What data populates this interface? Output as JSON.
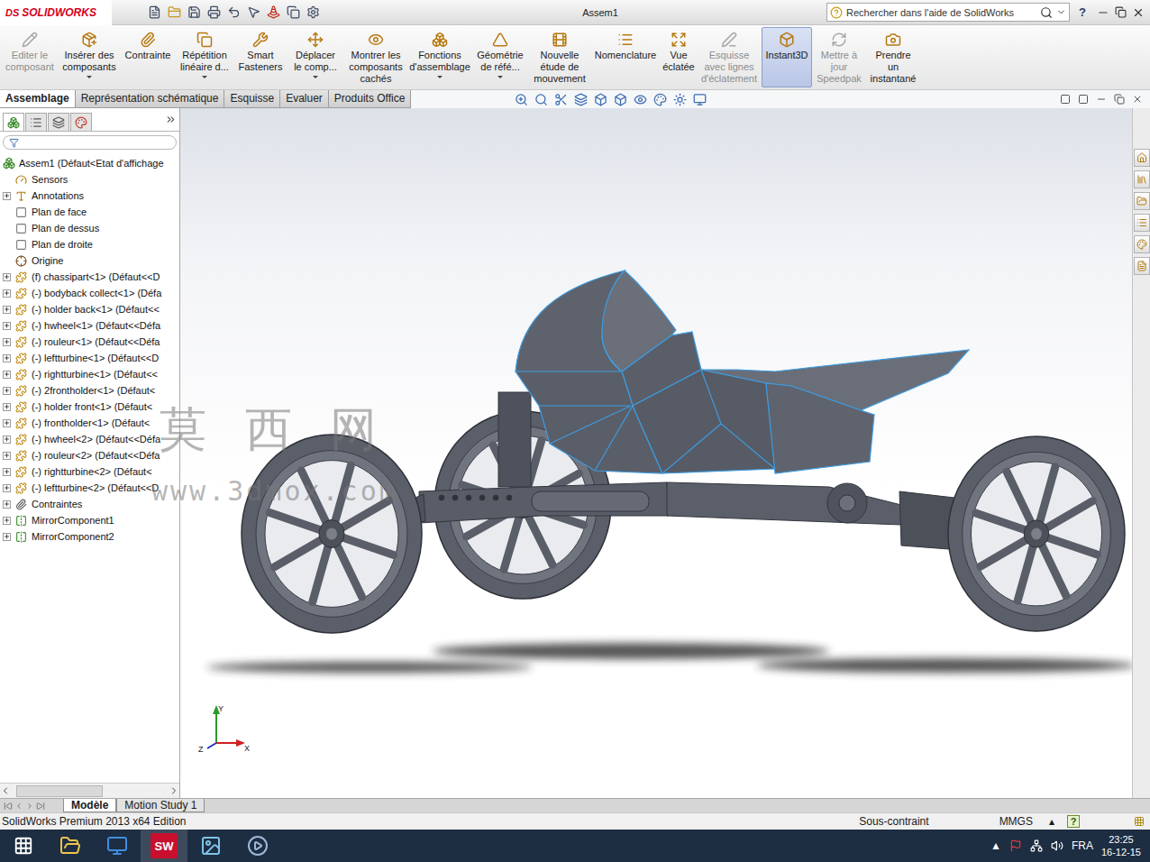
{
  "app": {
    "logo_mark": "DS",
    "logo_text": "SOLIDWORKS",
    "title": "Assem1",
    "help": "?"
  },
  "search": {
    "placeholder": "Rechercher dans l'aide de SolidWorks"
  },
  "ribbon": [
    {
      "lines": [
        "Editer le",
        "composant"
      ],
      "disabled": true,
      "selected": false,
      "dropdown": false
    },
    {
      "lines": [
        "Insérer des",
        "composants"
      ],
      "disabled": false,
      "selected": false,
      "dropdown": true
    },
    {
      "lines": [
        "Contrainte"
      ],
      "disabled": false,
      "selected": false,
      "dropdown": false
    },
    {
      "lines": [
        "Répétition",
        "linéaire d..."
      ],
      "disabled": false,
      "selected": false,
      "dropdown": true
    },
    {
      "lines": [
        "Smart",
        "Fasteners"
      ],
      "disabled": false,
      "selected": false,
      "dropdown": false
    },
    {
      "lines": [
        "Déplacer",
        "le comp..."
      ],
      "disabled": false,
      "selected": false,
      "dropdown": true
    },
    {
      "lines": [
        "Montrer les",
        "composants",
        "cachés"
      ],
      "disabled": false,
      "selected": false,
      "dropdown": false
    },
    {
      "lines": [
        "Fonctions",
        "d'assemblage"
      ],
      "disabled": false,
      "selected": false,
      "dropdown": true
    },
    {
      "lines": [
        "Géométrie",
        "de réfé..."
      ],
      "disabled": false,
      "selected": false,
      "dropdown": true
    },
    {
      "lines": [
        "Nouvelle",
        "étude de",
        "mouvement"
      ],
      "disabled": false,
      "selected": false,
      "dropdown": false
    },
    {
      "lines": [
        "Nomenclature"
      ],
      "disabled": false,
      "selected": false,
      "dropdown": false
    },
    {
      "lines": [
        "Vue",
        "éclatée"
      ],
      "disabled": false,
      "selected": false,
      "dropdown": false
    },
    {
      "lines": [
        "Esquisse",
        "avec lignes",
        "d'éclatement"
      ],
      "disabled": true,
      "selected": false,
      "dropdown": false
    },
    {
      "lines": [
        "Instant3D"
      ],
      "disabled": false,
      "selected": true,
      "dropdown": false
    },
    {
      "lines": [
        "Mettre à",
        "jour",
        "Speedpak"
      ],
      "disabled": true,
      "selected": false,
      "dropdown": false
    },
    {
      "lines": [
        "Prendre",
        "un",
        "instantané"
      ],
      "disabled": false,
      "selected": false,
      "dropdown": false
    }
  ],
  "tabs": [
    {
      "label": "Assemblage",
      "selected": true
    },
    {
      "label": "Représentation schématique",
      "selected": false
    },
    {
      "label": "Esquisse",
      "selected": false
    },
    {
      "label": "Evaluer",
      "selected": false
    },
    {
      "label": "Produits Office",
      "selected": false
    }
  ],
  "tree": {
    "root": "Assem1 (Défaut<Etat d'affichage",
    "items": [
      {
        "label": "Sensors",
        "kind": "sensor",
        "expandable": false
      },
      {
        "label": "Annotations",
        "kind": "annotation",
        "expandable": true
      },
      {
        "label": "Plan de face",
        "kind": "plane",
        "expandable": false
      },
      {
        "label": "Plan de dessus",
        "kind": "plane",
        "expandable": false
      },
      {
        "label": "Plan de droite",
        "kind": "plane",
        "expandable": false
      },
      {
        "label": "Origine",
        "kind": "origin",
        "expandable": false
      },
      {
        "label": "(f) chassipart<1> (Défaut<<D",
        "kind": "part",
        "expandable": true
      },
      {
        "label": "(-) bodyback collect<1> (Défa",
        "kind": "part",
        "expandable": true
      },
      {
        "label": "(-) holder back<1> (Défaut<<",
        "kind": "part",
        "expandable": true
      },
      {
        "label": "(-) hwheel<1> (Défaut<<Défa",
        "kind": "part",
        "expandable": true
      },
      {
        "label": "(-) rouleur<1> (Défaut<<Défa",
        "kind": "part",
        "expandable": true
      },
      {
        "label": "(-) leftturbine<1> (Défaut<<D",
        "kind": "part",
        "expandable": true
      },
      {
        "label": "(-) rightturbine<1> (Défaut<<",
        "kind": "part",
        "expandable": true
      },
      {
        "label": "(-) 2frontholder<1> (Défaut<",
        "kind": "part",
        "expandable": true
      },
      {
        "label": "(-) holder front<1> (Défaut<",
        "kind": "part",
        "expandable": true
      },
      {
        "label": "(-) frontholder<1> (Défaut<",
        "kind": "part",
        "expandable": true
      },
      {
        "label": "(-) hwheel<2> (Défaut<<Défa",
        "kind": "part",
        "expandable": true
      },
      {
        "label": "(-) rouleur<2> (Défaut<<Défa",
        "kind": "part",
        "expandable": true
      },
      {
        "label": "(-) rightturbine<2> (Défaut<",
        "kind": "part",
        "expandable": true
      },
      {
        "label": "(-) leftturbine<2> (Défaut<<D",
        "kind": "part",
        "expandable": true
      },
      {
        "label": "Contraintes",
        "kind": "mates",
        "expandable": true
      },
      {
        "label": "MirrorComponent1",
        "kind": "mirror",
        "expandable": true
      },
      {
        "label": "MirrorComponent2",
        "kind": "mirror",
        "expandable": true
      }
    ]
  },
  "graphics": {
    "watermark": [
      "莫 西 网",
      "www.3dmox.com"
    ],
    "triad": [
      "Y",
      "Z",
      "X"
    ]
  },
  "bottom_tabs": [
    {
      "label": "Modèle",
      "selected": true
    },
    {
      "label": "Motion Study 1",
      "selected": false
    }
  ],
  "status_bar": {
    "edition": "SolidWorks Premium 2013 x64 Edition",
    "state": "Sous-contraint",
    "units": "MMGS",
    "units_arrow": "▴",
    "help": "?"
  },
  "taskbar": {
    "sw_label": "SW",
    "tray_arrow": "▲",
    "language": "FRA",
    "time": "23:25",
    "date": "16-12-15"
  }
}
